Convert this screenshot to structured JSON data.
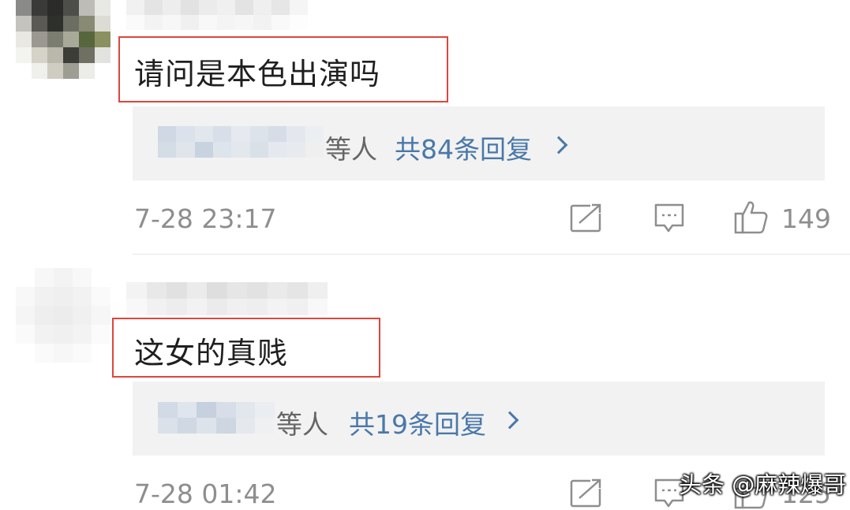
{
  "comments": [
    {
      "content": "请问是本色出演吗",
      "reply_others": "等人",
      "reply_count": "共84条回复",
      "timestamp": "7-28 23:17",
      "likes": "149"
    },
    {
      "content": "这女的真贱",
      "reply_others": "等人",
      "reply_count": "共19条回复",
      "timestamp": "7-28 01:42",
      "likes": "125"
    }
  ],
  "watermark": {
    "text": "头条 @麻辣爆哥"
  },
  "colors": {
    "highlight_border": "#e0453c",
    "link_blue": "#4a78a8",
    "meta_gray": "#8e8e8e"
  },
  "icons": [
    "repost-icon",
    "comment-icon",
    "thumbs-up-icon"
  ]
}
